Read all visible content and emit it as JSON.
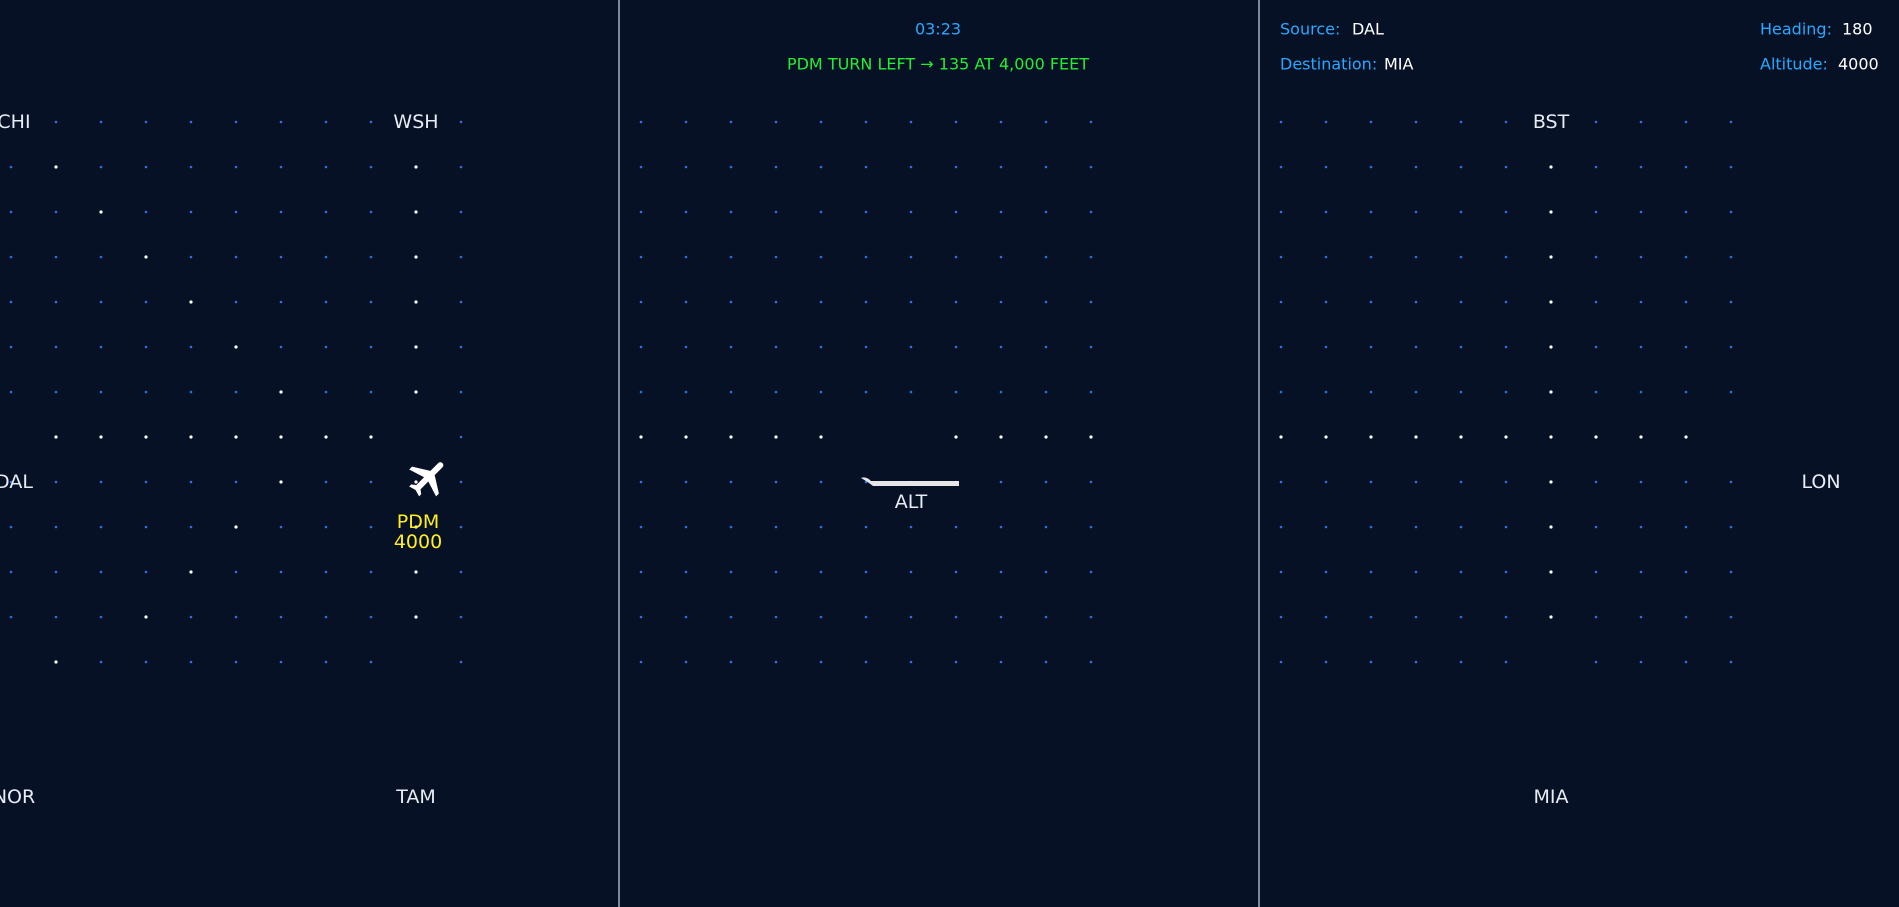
{
  "header": {
    "clock": "03:23",
    "instruction": "PDM TURN LEFT → 135 AT 4,000 FEET"
  },
  "flight_info": {
    "source_label": "Source:",
    "source_value": "DAL",
    "destination_label": "Destination:",
    "destination_value": "MIA",
    "heading_label": "Heading:",
    "heading_value": "180",
    "altitude_label": "Altitude:",
    "altitude_value": "4000"
  },
  "waypoints": {
    "chi": "CHI",
    "wsh": "WSH",
    "dal": "DAL",
    "nor": "NOR",
    "tam": "TAM",
    "bst": "BST",
    "lon": "LON",
    "mia": "MIA"
  },
  "aircraft": {
    "callsign": "PDM",
    "altitude": "4000"
  },
  "runway": {
    "label": "ALT"
  },
  "colors": {
    "background": "#061126",
    "grid_dot": "#2f6fe0",
    "route_dot": "#ffffff",
    "accent": "#29a8ff",
    "instruction": "#22ee33",
    "aircraft_tag": "#ffee22"
  },
  "icons": {
    "aircraft": "airplane-icon"
  }
}
